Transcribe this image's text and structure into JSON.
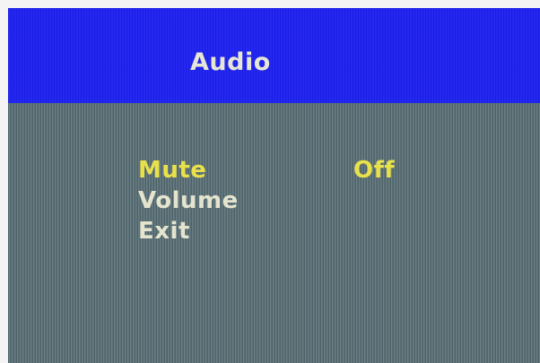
{
  "osd": {
    "title": "Audio",
    "items": [
      {
        "label": "Mute",
        "value": "Off",
        "selected": true
      },
      {
        "label": "Volume",
        "value": ""
      },
      {
        "label": "Exit",
        "value": ""
      }
    ]
  },
  "colors": {
    "header_background": "#1d21f0",
    "body_background": "#5d7278",
    "title_text": "#e6e6d4",
    "selected_text": "#e9e14a",
    "normal_text": "#e4e4cf"
  }
}
